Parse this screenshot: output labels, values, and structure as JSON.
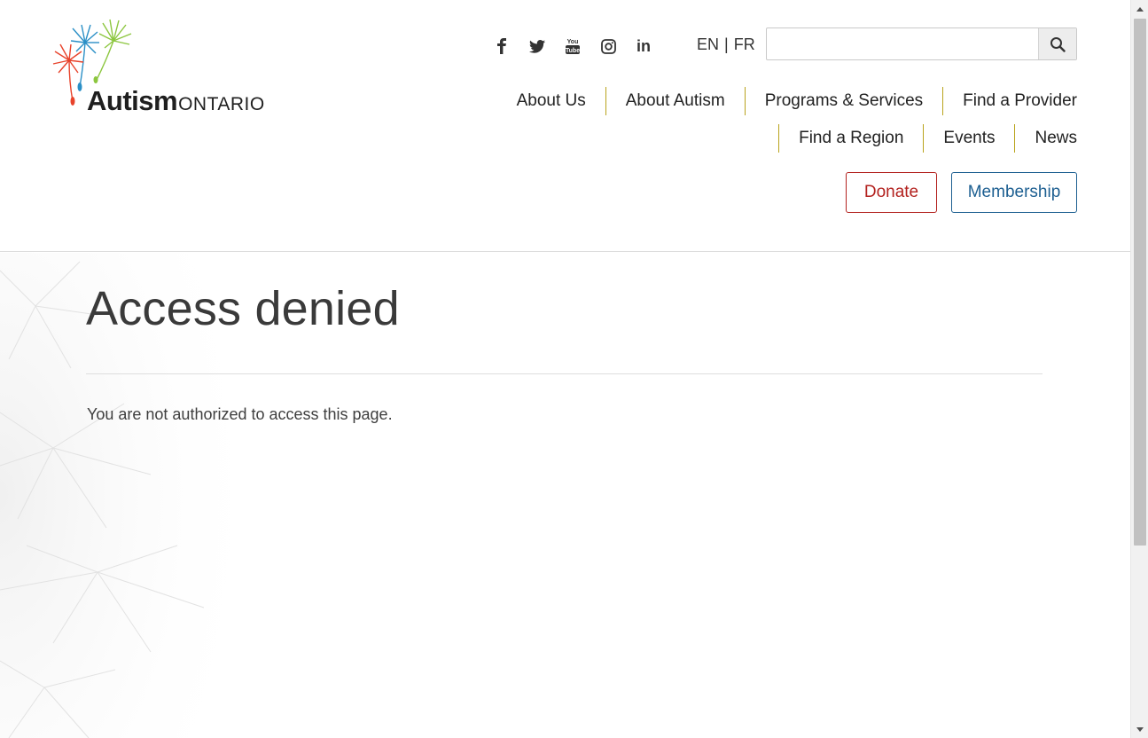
{
  "header": {
    "logo": {
      "name_bold": "Autism",
      "name_light": "ONTARIO"
    },
    "social": [
      {
        "icon": "facebook-icon"
      },
      {
        "icon": "twitter-icon"
      },
      {
        "icon": "youtube-icon",
        "text_top": "You",
        "text_bottom": "Tube"
      },
      {
        "icon": "instagram-icon"
      },
      {
        "icon": "linkedin-icon",
        "text": "in"
      }
    ],
    "lang": {
      "en": "EN",
      "separator": "|",
      "fr": "FR"
    },
    "search": {
      "placeholder": "",
      "value": "",
      "icon": "search-icon"
    },
    "nav_row1": [
      "About Us",
      "About Autism",
      "Programs & Services",
      "Find a Provider"
    ],
    "nav_row2": [
      "Find a Region",
      "Events",
      "News"
    ],
    "donate_label": "Donate",
    "membership_label": "Membership",
    "colors": {
      "nav_divider": "#b9a31c",
      "donate": "#b3221f",
      "membership": "#1d5f91"
    }
  },
  "main": {
    "title": "Access denied",
    "message": "You are not authorized to access this page."
  }
}
